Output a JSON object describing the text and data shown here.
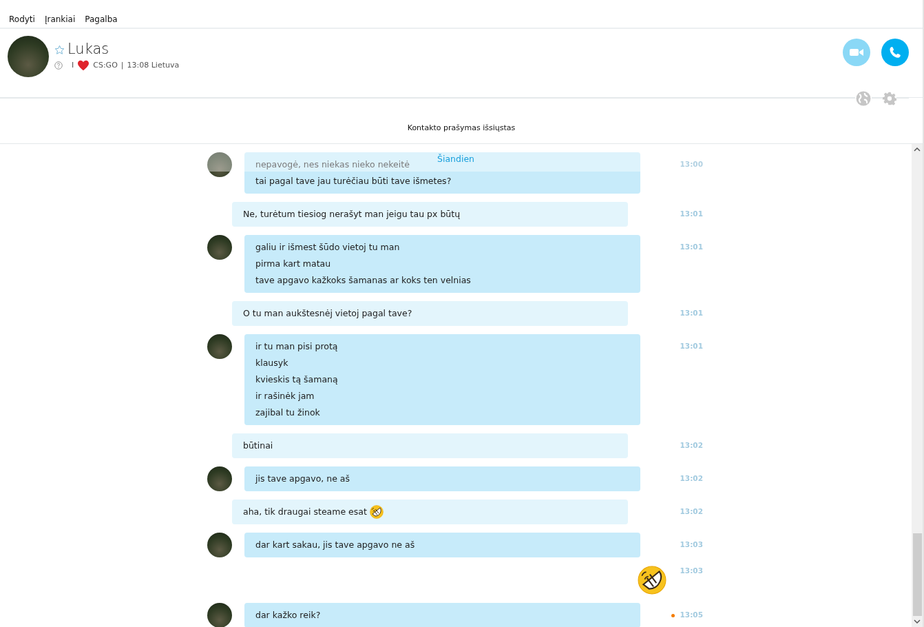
{
  "menu": [
    {
      "label": "Rodyti"
    },
    {
      "label": "Įrankiai"
    },
    {
      "label": "Pagalba"
    }
  ],
  "contact": {
    "name": "Lukas",
    "favorite": false,
    "mood_start": "I",
    "mood_end": "CS:GO",
    "separator": "|",
    "local_time": "13:08 Lietuva"
  },
  "call_buttons": [
    {
      "kind": "video",
      "disabled": true
    },
    {
      "kind": "call",
      "disabled": false
    }
  ],
  "notice": "Kontakto prašymas išsiųstas",
  "date_divider": "Šiandien",
  "messages": [
    {
      "kind": "received",
      "lines": [
        "nepavogė, nes niekas nieko nekeitė",
        "tai pagal tave jau turėčiau būti tave išmetes?"
      ],
      "time": "13:00"
    },
    {
      "kind": "sent",
      "lines": [
        "Ne, turėtum tiesiog nerašyt man jeigu tau px būtų"
      ],
      "time": "13:01"
    },
    {
      "kind": "received",
      "lines": [
        "galiu ir išmest šūdo vietoj tu man",
        "pirma kart matau",
        "tave apgavo kažkoks šamanas ar koks ten velnias"
      ],
      "time": "13:01"
    },
    {
      "kind": "sent",
      "lines": [
        "O tu man aukštesnėj vietoj pagal tave?"
      ],
      "time": "13:01"
    },
    {
      "kind": "received",
      "lines": [
        "ir tu man pisi protą",
        "klausyk",
        "kvieskis tą šamaną",
        "ir rašinėk jam",
        "zajibal tu žinok"
      ],
      "time": "13:01"
    },
    {
      "kind": "sent",
      "lines": [
        "būtinai"
      ],
      "time": "13:02"
    },
    {
      "kind": "received",
      "lines": [
        "jis tave apgavo, ne aš"
      ],
      "time": "13:02"
    },
    {
      "kind": "sent",
      "lines": [
        "aha, tik draugai steame esat"
      ],
      "emoji_after": true,
      "time": "13:02"
    },
    {
      "kind": "received",
      "lines": [
        "dar kart sakau, jis tave apgavo ne aš"
      ],
      "time": "13:03"
    },
    {
      "kind": "emoji",
      "time": "13:03"
    },
    {
      "kind": "received",
      "lines": [
        "dar kažko reik?"
      ],
      "time": "13:05",
      "unread": true
    }
  ]
}
